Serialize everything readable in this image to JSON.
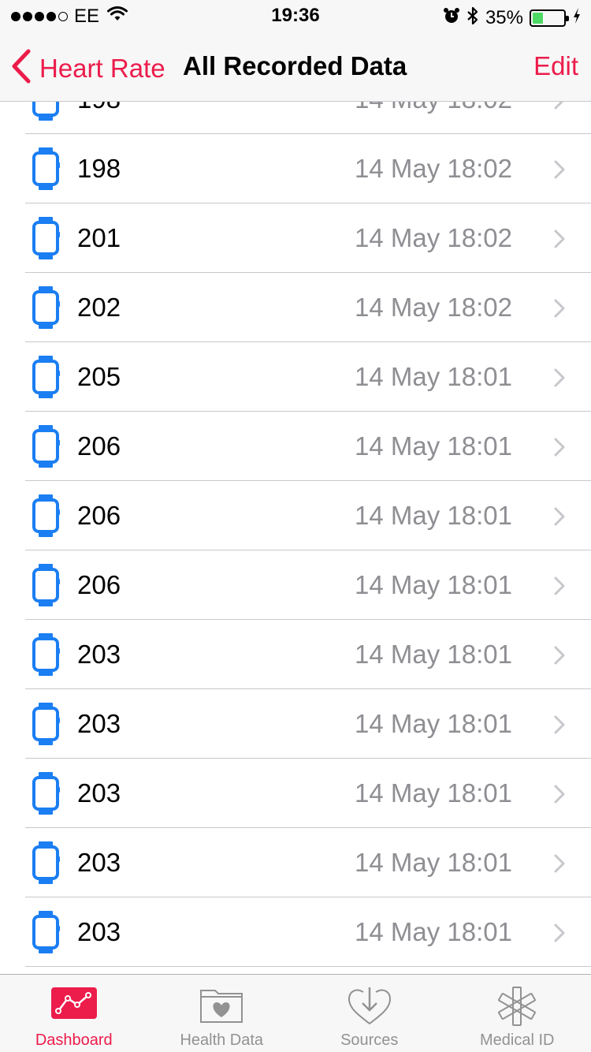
{
  "status_bar": {
    "carrier": "EE",
    "time": "19:36",
    "battery": "35%",
    "battery_level": 0.35,
    "signal_bars_filled": 4,
    "icons": [
      "wifi-icon",
      "alarm-icon",
      "bluetooth-icon",
      "charging-icon"
    ]
  },
  "nav": {
    "back_label": "Heart Rate",
    "title": "All Recorded Data",
    "edit_label": "Edit"
  },
  "colors": {
    "accent": "#ec1c4b",
    "watch_icon": "#1b7ef2",
    "secondary_text": "#8e8e93"
  },
  "rows": [
    {
      "value": "198",
      "date": "14 May 18:02"
    },
    {
      "value": "198",
      "date": "14 May 18:02"
    },
    {
      "value": "201",
      "date": "14 May 18:02"
    },
    {
      "value": "202",
      "date": "14 May 18:02"
    },
    {
      "value": "205",
      "date": "14 May 18:01"
    },
    {
      "value": "206",
      "date": "14 May 18:01"
    },
    {
      "value": "206",
      "date": "14 May 18:01"
    },
    {
      "value": "206",
      "date": "14 May 18:01"
    },
    {
      "value": "203",
      "date": "14 May 18:01"
    },
    {
      "value": "203",
      "date": "14 May 18:01"
    },
    {
      "value": "203",
      "date": "14 May 18:01"
    },
    {
      "value": "203",
      "date": "14 May 18:01"
    },
    {
      "value": "203",
      "date": "14 May 18:01"
    }
  ],
  "tabs": [
    {
      "label": "Dashboard",
      "icon": "dashboard-icon",
      "active": true
    },
    {
      "label": "Health Data",
      "icon": "health-data-icon",
      "active": false
    },
    {
      "label": "Sources",
      "icon": "sources-icon",
      "active": false
    },
    {
      "label": "Medical ID",
      "icon": "medical-id-icon",
      "active": false
    }
  ]
}
